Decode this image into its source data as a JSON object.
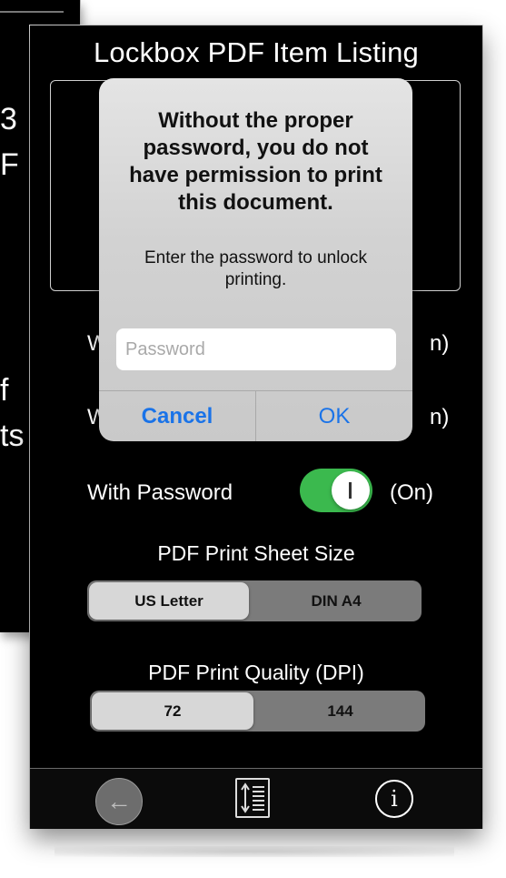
{
  "background_window": {
    "fragments": [
      "3",
      "F",
      "f",
      "ts"
    ]
  },
  "screen": {
    "title": "Lockbox PDF Item Listing",
    "rows": [
      {
        "label": "W",
        "state": "n)"
      },
      {
        "label": "W",
        "state": "n)"
      },
      {
        "label": "With Password",
        "state": "(On)",
        "toggle_on": true
      }
    ],
    "accent_green": "#3bb94e",
    "sheet_size": {
      "label": "PDF Print Sheet Size",
      "options": [
        "US Letter",
        "DIN A4"
      ],
      "selected": "US Letter"
    },
    "print_quality": {
      "label": "PDF Print Quality (DPI)",
      "options": [
        "72",
        "144"
      ],
      "selected": "72"
    },
    "bottom_bar": {
      "back_icon": "arrow-left-icon",
      "back_glyph": "←",
      "sort_icon": "sort-lines-icon",
      "info_icon": "info-circle-icon",
      "info_glyph": "i"
    }
  },
  "alert": {
    "title": "Without the proper password, you do not have permission to print this document.",
    "message": "Enter the password to unlock printing.",
    "input": {
      "value": "",
      "placeholder": "Password"
    },
    "buttons": {
      "cancel": "Cancel",
      "ok": "OK"
    },
    "button_color": "#1a73e8"
  }
}
